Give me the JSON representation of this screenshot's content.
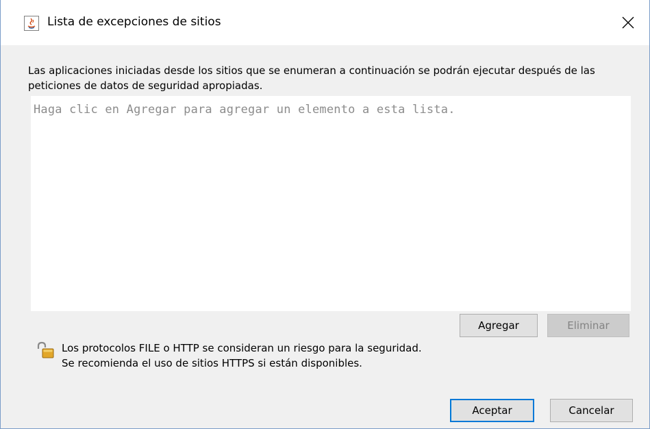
{
  "window": {
    "title": "Lista de excepciones de sitios",
    "app_icon": "java-icon",
    "close_icon": "close-icon"
  },
  "description": "Las aplicaciones iniciadas desde los sitios que se enumeran a continuación se podrán ejecutar después de las peticiones de datos de seguridad apropiadas.",
  "list": {
    "placeholder": "Haga clic en Agregar para agregar un elemento a esta lista."
  },
  "list_buttons": {
    "add_label": "Agregar",
    "remove_label": "Eliminar"
  },
  "warning": {
    "icon": "unlocked-padlock-icon",
    "line1": "Los protocolos FILE o HTTP se consideran un riesgo para la seguridad.",
    "line2": "Se recomienda el uso de sitios HTTPS si están disponibles."
  },
  "footer": {
    "ok_label": "Aceptar",
    "cancel_label": "Cancelar"
  },
  "colors": {
    "window_bg": "#f0f0f0",
    "focus_border": "#0078d7",
    "placeholder_text": "#8c8c8c"
  }
}
